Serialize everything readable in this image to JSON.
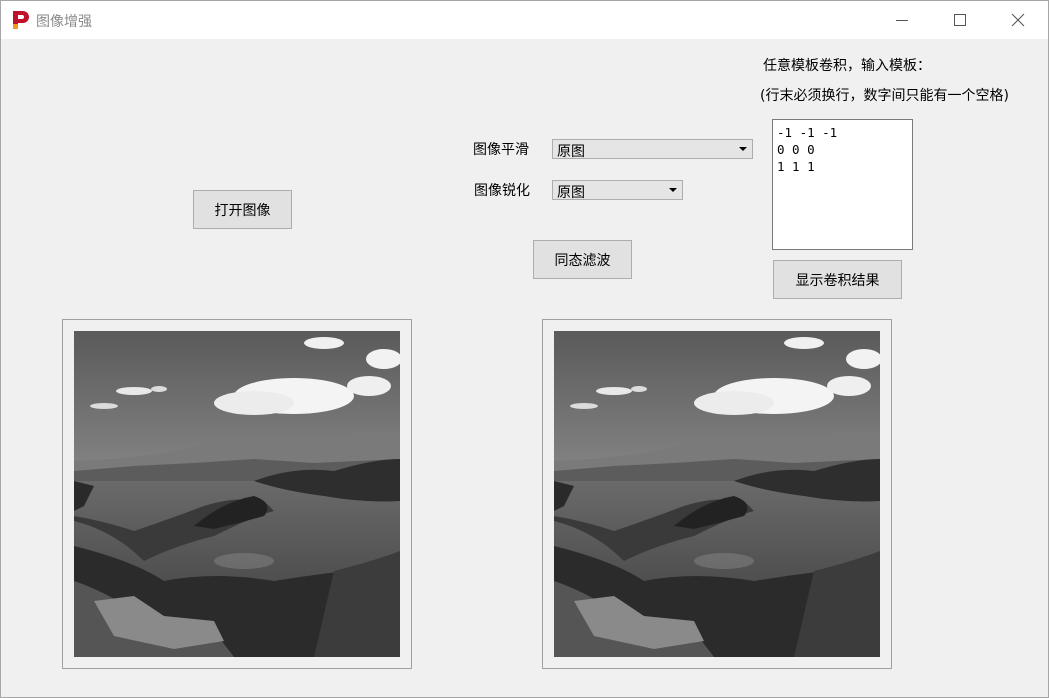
{
  "window": {
    "title": "图像增强"
  },
  "controls": {
    "open_button": "打开图像",
    "smooth_label": "图像平滑",
    "smooth_value": "原图",
    "sharpen_label": "图像锐化",
    "sharpen_value": "原图",
    "homomorphic_button": "同态滤波",
    "conv_title": "任意模板卷积，输入模板：",
    "conv_hint": "(行末必须换行，数字间只能有一个空格)",
    "kernel_lines": [
      "-1 -1 -1",
      "0 0 0",
      "1 1 1"
    ],
    "show_conv_button": "显示卷积结果"
  },
  "icons": {
    "app": "app-logo-icon",
    "minimize": "minimize-icon",
    "maximize": "maximize-icon",
    "close": "close-icon"
  },
  "colors": {
    "app_icon": "#c0102a"
  }
}
